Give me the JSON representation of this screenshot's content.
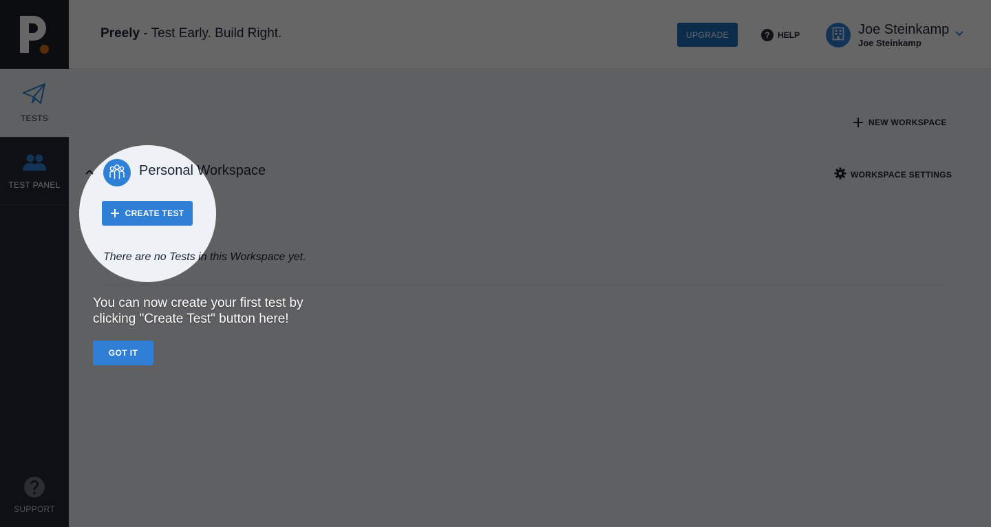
{
  "sidebar": {
    "items": [
      {
        "label": "TESTS",
        "icon": "paper-plane-icon",
        "active": true
      },
      {
        "label": "TEST PANEL",
        "icon": "people-icon",
        "active": false
      }
    ],
    "support_label": "SUPPORT"
  },
  "header": {
    "brand": "Preely",
    "tagline": "- Test Early. Build Right.",
    "upgrade_label": "UPGRADE",
    "help_label": "HELP",
    "user_name": "Joe Steinkamp",
    "user_subtitle": "Joe Steinkamp"
  },
  "main": {
    "new_workspace_label": "NEW WORKSPACE",
    "workspace_title": "Personal Workspace",
    "workspace_settings_label": "WORKSPACE SETTINGS",
    "create_test_label": "CREATE TEST",
    "empty_message": "There are no Tests in this Workspace yet."
  },
  "tour": {
    "message": "You can now create your first test by clicking \"Create Test\" button here!",
    "got_it_label": "GOT IT"
  },
  "colors": {
    "accent": "#2f7fd6",
    "upgrade": "#1f6fbf",
    "sidebar": "#252a36",
    "logo_dot": "#d9701f"
  }
}
